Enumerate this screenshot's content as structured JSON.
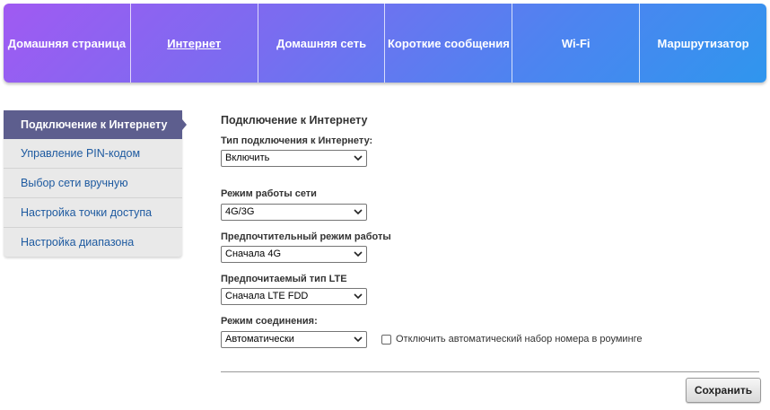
{
  "nav": {
    "tabs": [
      {
        "label": "Домашняя страница"
      },
      {
        "label": "Интернет"
      },
      {
        "label": "Домашняя сеть"
      },
      {
        "label": "Короткие сообщения"
      },
      {
        "label": "Wi-Fi"
      },
      {
        "label": "Маршрутизатор"
      }
    ],
    "active_index": 1
  },
  "sidebar": {
    "items": [
      {
        "label": "Подключение к Интернету"
      },
      {
        "label": "Управление PIN-кодом"
      },
      {
        "label": "Выбор сети вручную"
      },
      {
        "label": "Настройка точки доступа"
      },
      {
        "label": "Настройка диапазона"
      }
    ],
    "active_index": 0
  },
  "main": {
    "title": "Подключение к Интернету",
    "connection_type": {
      "label": "Тип подключения к Интернету:",
      "value": "Включить"
    },
    "network_mode": {
      "label": "Режим работы сети",
      "value": "4G/3G"
    },
    "preferred_mode": {
      "label": "Предпочтительный режим работы",
      "value": "Сначала 4G"
    },
    "lte_type": {
      "label": "Предпочитаемый тип LTE",
      "value": "Сначала LTE FDD"
    },
    "connection_mode": {
      "label": "Режим соединения:",
      "value": "Автоматически"
    },
    "roaming_checkbox": {
      "label": "Отключить автоматический набор номера в роуминге",
      "checked": false
    },
    "save_label": "Сохранить"
  },
  "icons": {
    "select_arrow": "chevron-down-icon"
  },
  "colors": {
    "nav_gradient_start": "#a05af2",
    "nav_gradient_end": "#2f96ee",
    "sidebar_active": "#5d5e8e",
    "sidebar_link": "#1e5aa0"
  }
}
